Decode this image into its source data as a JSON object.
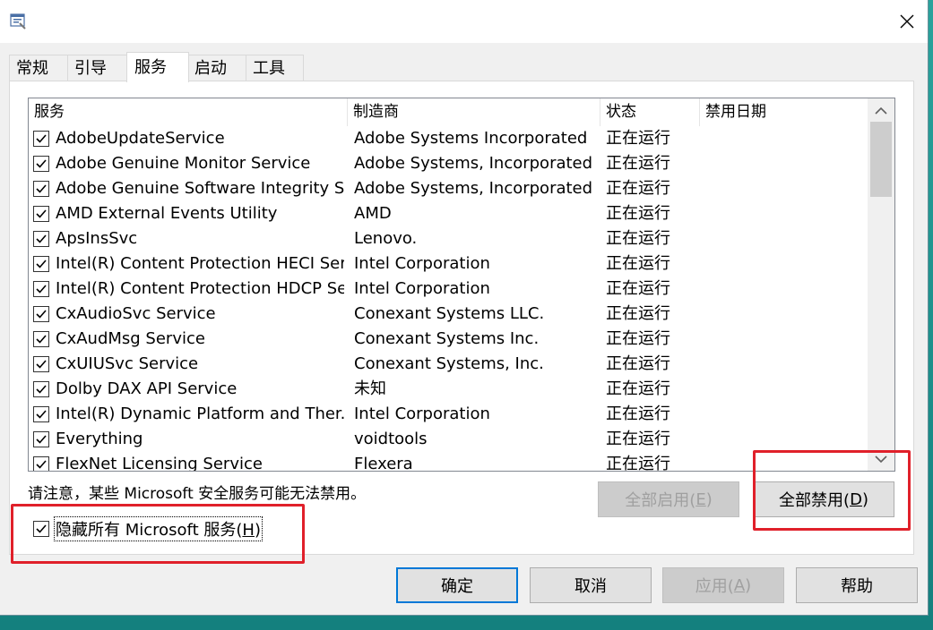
{
  "window": {
    "icon": "msconfig-icon",
    "close_icon": "close-icon"
  },
  "tabs": [
    {
      "label": "常规"
    },
    {
      "label": "引导"
    },
    {
      "label": "服务"
    },
    {
      "label": "启动"
    },
    {
      "label": "工具"
    }
  ],
  "active_tab": "服务",
  "list": {
    "columns": [
      "服务",
      "制造商",
      "状态",
      "禁用日期"
    ],
    "rows": [
      {
        "name": "AdobeUpdateService",
        "maker": "Adobe Systems Incorporated",
        "status": "正在运行",
        "checked": true
      },
      {
        "name": "Adobe Genuine Monitor Service",
        "maker": "Adobe Systems, Incorporated",
        "status": "正在运行",
        "checked": true
      },
      {
        "name": "Adobe Genuine Software Integrity S...",
        "maker": "Adobe Systems, Incorporated",
        "status": "正在运行",
        "checked": true
      },
      {
        "name": "AMD External Events Utility",
        "maker": "AMD",
        "status": "正在运行",
        "checked": true
      },
      {
        "name": "ApsInsSvc",
        "maker": "Lenovo.",
        "status": "正在运行",
        "checked": true
      },
      {
        "name": "Intel(R) Content Protection HECI Ser...",
        "maker": "Intel Corporation",
        "status": "正在运行",
        "checked": true
      },
      {
        "name": "Intel(R) Content Protection HDCP Se...",
        "maker": "Intel Corporation",
        "status": "正在运行",
        "checked": true
      },
      {
        "name": "CxAudioSvc Service",
        "maker": "Conexant Systems LLC.",
        "status": "正在运行",
        "checked": true
      },
      {
        "name": "CxAudMsg Service",
        "maker": "Conexant Systems Inc.",
        "status": "正在运行",
        "checked": true
      },
      {
        "name": "CxUIUSvc Service",
        "maker": "Conexant Systems, Inc.",
        "status": "正在运行",
        "checked": true
      },
      {
        "name": "Dolby DAX API Service",
        "maker": "未知",
        "status": "正在运行",
        "checked": true
      },
      {
        "name": "Intel(R) Dynamic Platform and Ther...",
        "maker": "Intel Corporation",
        "status": "正在运行",
        "checked": true
      },
      {
        "name": "Everything",
        "maker": "voidtools",
        "status": "正在运行",
        "checked": true
      },
      {
        "name": "FlexNet Licensing Service",
        "maker": "Flexera",
        "status": "正在运行",
        "checked": true
      }
    ]
  },
  "note": "请注意，某些 Microsoft 安全服务可能无法禁用。",
  "buttons": {
    "enable_all": {
      "label": "全部启用(",
      "key": "E",
      "suffix": ")"
    },
    "disable_all": {
      "label": "全部禁用(",
      "key": "D",
      "suffix": ")"
    },
    "ok": "确定",
    "cancel": "取消",
    "apply": {
      "label": "应用(",
      "key": "A",
      "suffix": ")"
    },
    "help": "帮助"
  },
  "hide_ms": {
    "label": "隐藏所有 Microsoft 服务(",
    "key": "H",
    "suffix": ")",
    "checked": true
  },
  "colors": {
    "highlight": "#e0202a",
    "accent": "#0078d7"
  }
}
